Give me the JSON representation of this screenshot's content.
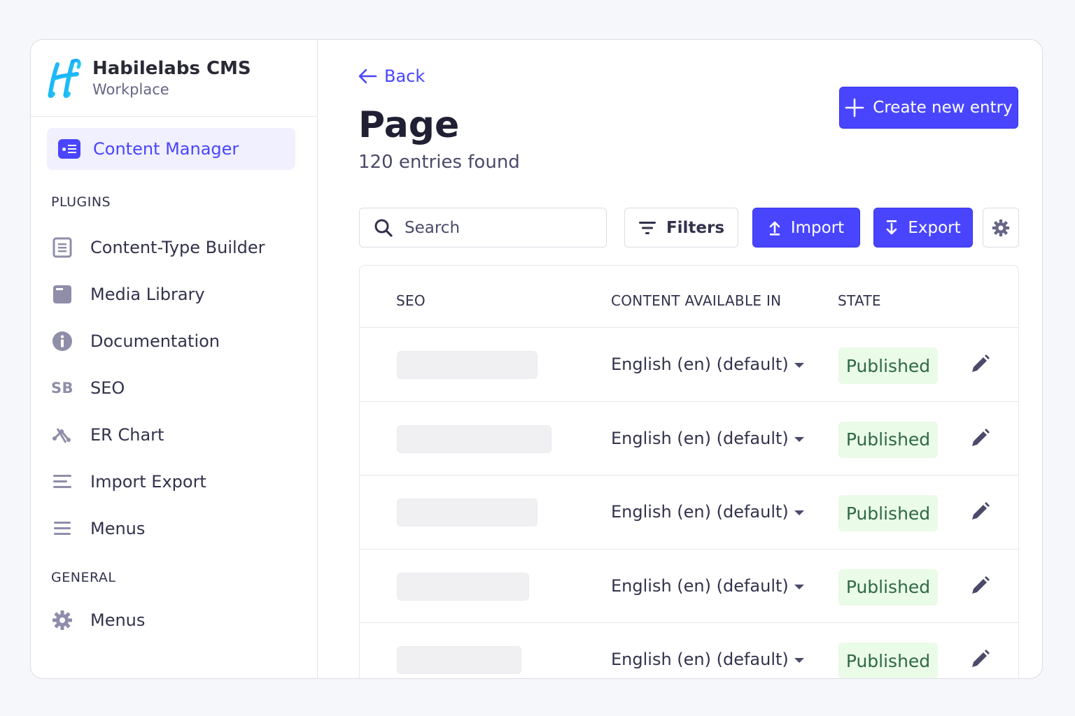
{
  "brand": {
    "name": "Habilelabs CMS",
    "workspace": "Workplace"
  },
  "sidebar": {
    "active_item": "Content Manager",
    "plugins_title": "PLUGINS",
    "plugins": [
      {
        "label": "Content-Type Builder",
        "icon": "content-type-builder-icon"
      },
      {
        "label": "Media Library",
        "icon": "media-library-icon"
      },
      {
        "label": "Documentation",
        "icon": "info-icon"
      },
      {
        "label": "SEO",
        "icon": "sb-icon",
        "icon_text": "SB"
      },
      {
        "label": "ER Chart",
        "icon": "er-chart-icon"
      },
      {
        "label": "Import Export",
        "icon": "import-export-icon"
      },
      {
        "label": "Menus",
        "icon": "menu-icon"
      }
    ],
    "general_title": "GENERAL",
    "general": [
      {
        "label": "Menus",
        "icon": "gear-icon"
      }
    ]
  },
  "header": {
    "back_label": "Back",
    "title": "Page",
    "count_text": "120 entries found",
    "create_label": "Create new entry"
  },
  "toolbar": {
    "search_placeholder": "Search",
    "filters_label": "Filters",
    "import_label": "Import",
    "export_label": "Export"
  },
  "table": {
    "columns": [
      "SEO",
      "CONTENT AVAILABLE IN",
      "STATE"
    ],
    "rows": [
      {
        "locale": "English (en) (default)",
        "state": "Published"
      },
      {
        "locale": "English (en) (default)",
        "state": "Published"
      },
      {
        "locale": "English (en) (default)",
        "state": "Published"
      },
      {
        "locale": "English (en) (default)",
        "state": "Published"
      },
      {
        "locale": "English (en) (default)",
        "state": "Published"
      }
    ]
  },
  "colors": {
    "accent": "#4945ff",
    "published_bg": "#eafbe7",
    "published_text": "#2f6846",
    "logo_gradient": [
      "#1aa3ff",
      "#22d3ee"
    ]
  }
}
